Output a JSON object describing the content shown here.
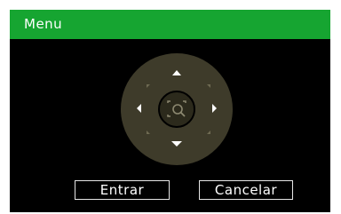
{
  "dialog": {
    "title": "Menu",
    "title_bar_color": "#16a531"
  },
  "ptz_pad": {
    "pad_color": "#3e3b2a",
    "arrow_color": "#ffffff",
    "center_icon": "zoom-search-icon",
    "directions": [
      "up",
      "down",
      "left",
      "right",
      "up-left",
      "up-right",
      "down-left",
      "down-right"
    ]
  },
  "buttons": {
    "enter_label": "Entrar",
    "cancel_label": "Cancelar"
  }
}
